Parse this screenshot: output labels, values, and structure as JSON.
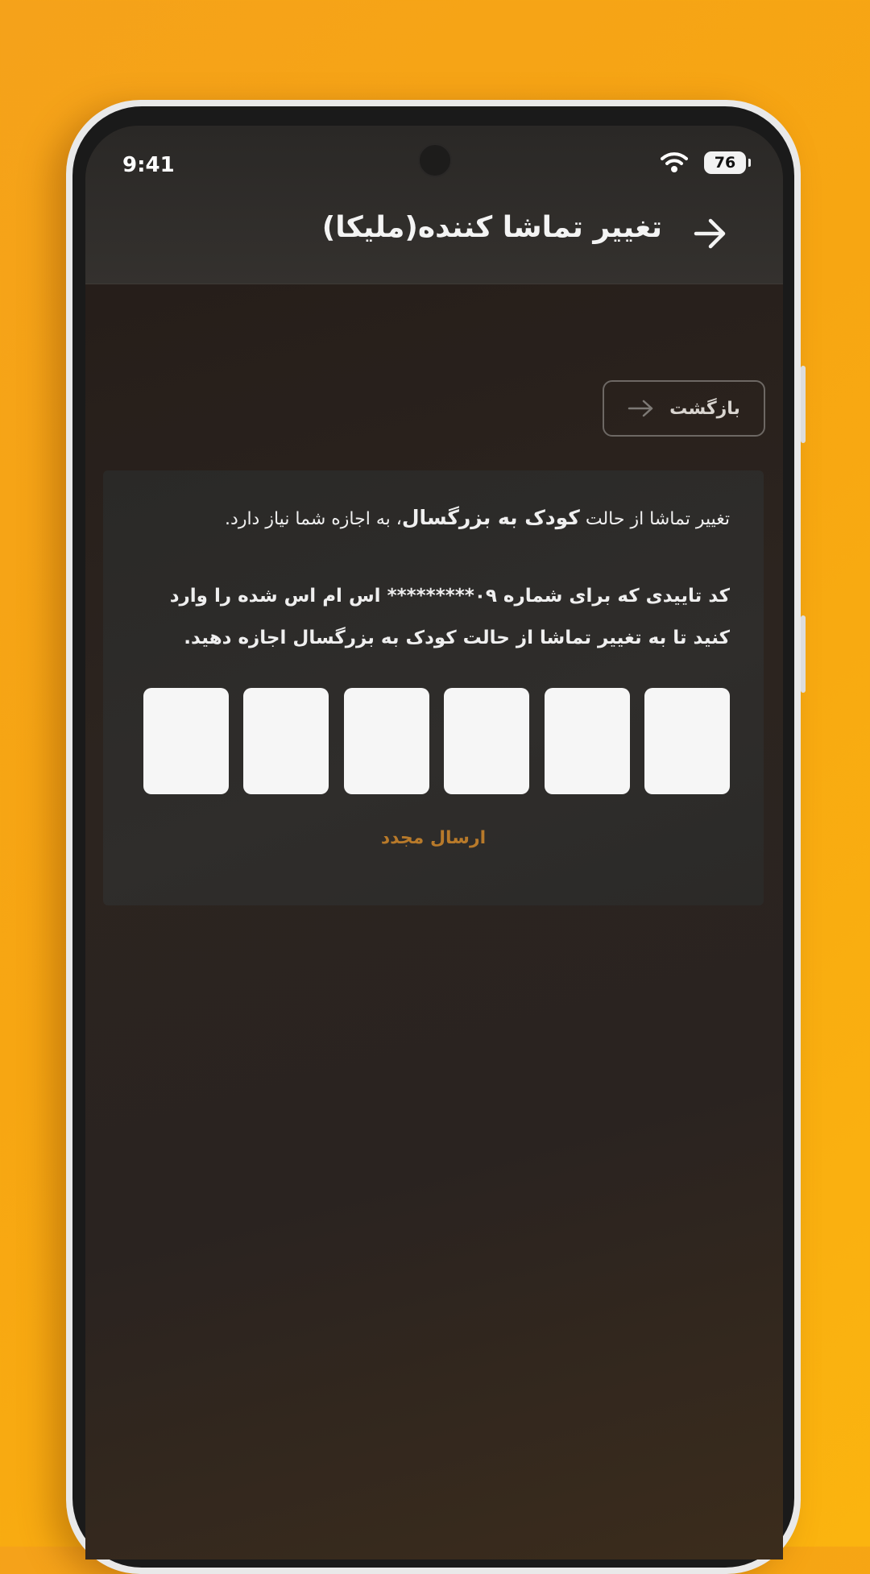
{
  "status_bar": {
    "time": "9:41",
    "battery": "76"
  },
  "app_bar": {
    "title": "تغییر تماشا کننده(ملیکا)"
  },
  "back_button": {
    "label": "بازگشت"
  },
  "card": {
    "intro_prefix": "تغییر تماشا از حالت ",
    "intro_bold": "کودک به بزرگسال",
    "intro_suffix": "، به اجازه شما نیاز دارد.",
    "instructions": "کد تاییدی که برای شماره ۰۹********* اس ام اس شده را وارد کنید تا به تغییر تماشا از حالت کودک به بزرگسال اجازه دهید.",
    "otp_length": 6,
    "resend_label": "ارسال مجدد"
  },
  "colors": {
    "background": "#f7a612",
    "accent": "#b87a2a",
    "otp_box": "#f6f6f6"
  }
}
